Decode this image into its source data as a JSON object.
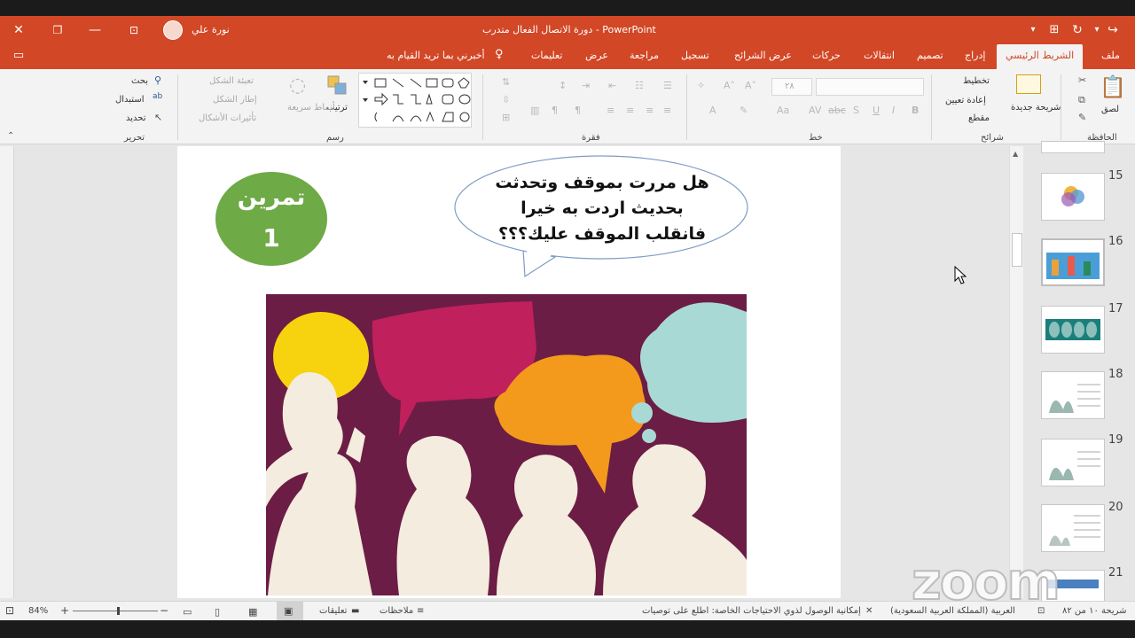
{
  "app": {
    "title": "دورة الاتصال الفعال متدرب  -  PowerPoint",
    "user_name": "نورة علي"
  },
  "tabs": [
    {
      "label": "ملف"
    },
    {
      "label": "الشريط الرئيسي"
    },
    {
      "label": "إدراج"
    },
    {
      "label": "تصميم"
    },
    {
      "label": "انتقالات"
    },
    {
      "label": "حركات"
    },
    {
      "label": "عرض الشرائح"
    },
    {
      "label": "تسجيل"
    },
    {
      "label": "مراجعة"
    },
    {
      "label": "عرض"
    },
    {
      "label": "تعليمات"
    }
  ],
  "tell_me": "أخبرني بما تريد القيام به",
  "ribbon": {
    "clipboard": {
      "paste": "لصق",
      "label": "الحافظة"
    },
    "slides": {
      "new_slide": "شريحة جديدة",
      "layout": "تخطيط",
      "reset": "إعادة تعيين",
      "section": "مقطع",
      "label": "شرائح"
    },
    "font": {
      "label": "خط",
      "size": "٢٨"
    },
    "paragraph": {
      "label": "فقرة"
    },
    "drawing": {
      "arrange": "ترتيب",
      "quick_styles": "أنماط سريعة",
      "shape_fill": "تعبئة الشكل",
      "shape_outline": "إطار الشكل",
      "shape_effects": "تأثيرات الأشكال",
      "label": "رسم"
    },
    "editing": {
      "find": "بحث",
      "replace": "استبدال",
      "select": "تحديد",
      "label": "تحرير"
    }
  },
  "slide": {
    "badge_line1": "تمرين",
    "badge_line2": "1",
    "bubble_lines": [
      "هل مررت بموقف وتحدثت",
      "بحديث اردت به خيرا",
      "فانقلب الموقف عليك؟؟؟"
    ]
  },
  "thumbnails": [
    {
      "num": "15"
    },
    {
      "num": "16"
    },
    {
      "num": "17"
    },
    {
      "num": "18"
    },
    {
      "num": "19"
    },
    {
      "num": "20"
    },
    {
      "num": "21"
    }
  ],
  "status": {
    "slide_counter": "شريحة ١٠ من ٨٢",
    "language": "العربية (المملكة العربية السعودية)",
    "accessibility": "إمكانية الوصول لذوي الاحتياجات الخاصة: اطلع على توصيات",
    "notes": "ملاحظات",
    "comments": "تعليقات",
    "zoom": "84%"
  },
  "watermark": "zoom",
  "colors": {
    "accent": "#d24726",
    "badge": "#6eaa45",
    "photo_bg": "#6b1d45"
  }
}
